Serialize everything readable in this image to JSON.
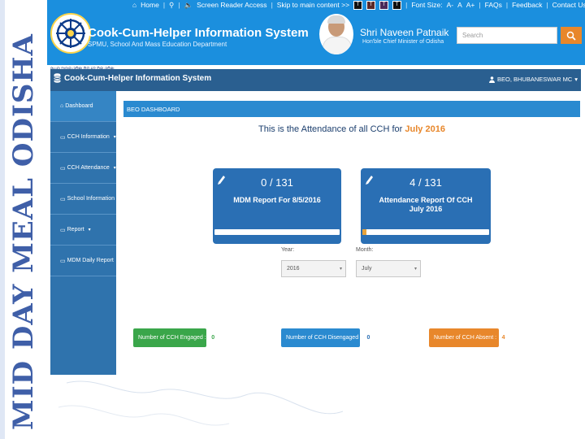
{
  "side_banner": {
    "text": "MID DAY MEAL ODISHA"
  },
  "header": {
    "topbar": {
      "home": "Home",
      "screen_reader": "Screen Reader Access",
      "skip": "Skip to main content >>",
      "font_size": "Font Size:",
      "font_small": "A-",
      "font_normal": "A",
      "font_large": "A+",
      "faqs": "FAQs",
      "feedback": "Feedback",
      "contact": "Contact Us"
    },
    "theme_buttons": [
      "T",
      "T",
      "T",
      "T"
    ],
    "logo_caption": "ସାଧ୍ୟ ଆହାର ଓଡ଼ିଶା ମିଡ୍ ଡେ ମିଲ୍ ଓଡ଼ିଶା",
    "title": "Cook-Cum-Helper Information System",
    "subtitle": "SPMU, School And Mass Education Department",
    "cm_name": "Shri Naveen Patnaik",
    "cm_title": "Hon'ble Chief Minister of Odisha",
    "search_placeholder": "Search"
  },
  "app": {
    "brand": "Cook-Cum-Helper Information System",
    "user": "BEO, BHUBANESWAR MC",
    "user_caret": "▾",
    "sidebar": [
      {
        "label": "Dashboard",
        "caret": ""
      },
      {
        "label": "CCH Information",
        "caret": "▾"
      },
      {
        "label": "CCH Attendance",
        "caret": "▾"
      },
      {
        "label": "School Information",
        "caret": "▾"
      },
      {
        "label": "Report",
        "caret": "▾"
      },
      {
        "label": "MDM Daily Report",
        "caret": "▾"
      }
    ],
    "panel_title": "BEO DASHBOARD",
    "attendance_heading": "This is the Attendance of all CCH for",
    "attendance_period": "July  2016",
    "cards": [
      {
        "count": "0 / 131",
        "desc_line1": "MDM Report For 8/5/2016",
        "desc_line2": "",
        "progress": 0
      },
      {
        "count": "4 / 131",
        "desc_line1": "Attendance Report Of CCH",
        "desc_line2": "July 2016",
        "progress": 0.031
      }
    ],
    "filters": {
      "year_label": "Year:",
      "year_value": "2016",
      "month_label": "Month:",
      "month_value": "July",
      "caret": "▾"
    },
    "status": [
      {
        "label": "Number of CCH Engaged :",
        "count": "0",
        "color": "#3aa64a",
        "text_color": "#3aa64a"
      },
      {
        "label": "Number of CCH Disengaged :",
        "count": "0",
        "color": "#2a8ad0",
        "text_color": "#2a6fb4"
      },
      {
        "label": "Number of CCH Absent :",
        "count": "4",
        "color": "#e8872b",
        "text_color": "#e8872b"
      }
    ]
  }
}
